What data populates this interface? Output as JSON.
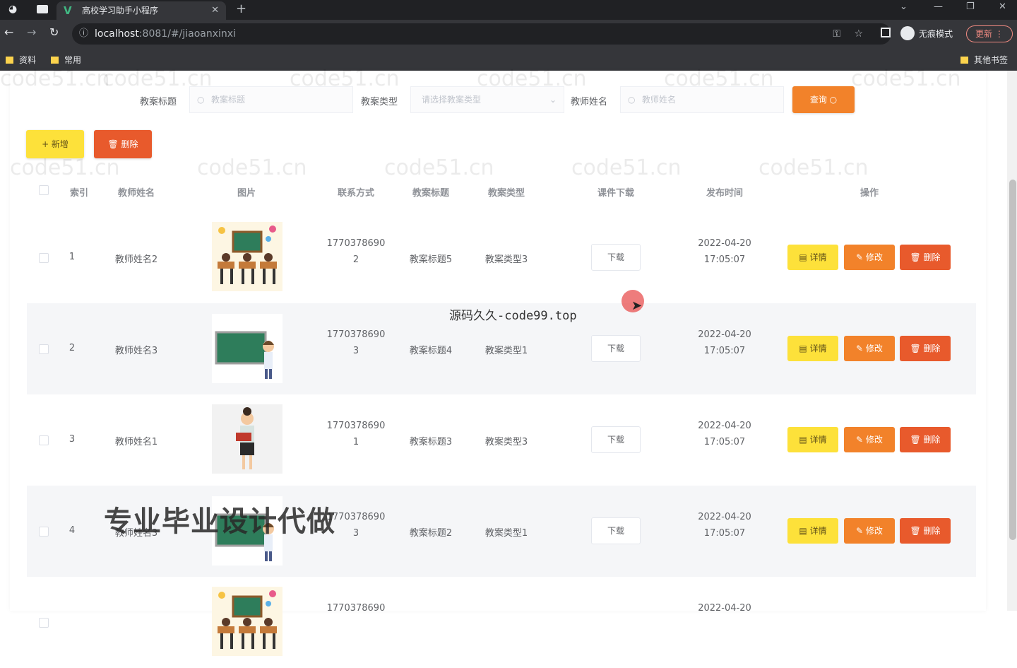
{
  "browser": {
    "tab_title": "高校学习助手小程序",
    "url_host": "localhost",
    "url_rest": ":8081/#/jiaoanxinxi",
    "incognito_label": "无痕模式",
    "update_label": "更新",
    "bookmarks": [
      "资料",
      "常用"
    ],
    "other_bookmarks": "其他书签"
  },
  "search": {
    "title_label": "教案标题",
    "title_placeholder": "教案标题",
    "type_label": "教案类型",
    "type_placeholder": "请选择教案类型",
    "teacher_label": "教师姓名",
    "teacher_placeholder": "教师姓名",
    "search_button": "查询"
  },
  "actions": {
    "add_label": "+ 新增",
    "delete_label": "删除"
  },
  "table": {
    "headers": {
      "index": "索引",
      "teacher": "教师姓名",
      "image": "图片",
      "contact": "联系方式",
      "title": "教案标题",
      "type": "教案类型",
      "download": "课件下载",
      "time": "发布时间",
      "ops": "操作"
    },
    "rows": [
      {
        "index": "1",
        "teacher": "教师姓名2",
        "contact_a": "1770378690",
        "contact_b": "2",
        "title": "教案标题5",
        "type": "教案类型3",
        "download": "下载",
        "date": "2022-04-20",
        "time": "17:05:07",
        "image": "classroom-students"
      },
      {
        "index": "2",
        "teacher": "教师姓名3",
        "contact_a": "1770378690",
        "contact_b": "3",
        "title": "教案标题4",
        "type": "教案类型1",
        "download": "下载",
        "date": "2022-04-20",
        "time": "17:05:07",
        "image": "teacher-blackboard"
      },
      {
        "index": "3",
        "teacher": "教师姓名1",
        "contact_a": "1770378690",
        "contact_b": "1",
        "title": "教案标题3",
        "type": "教案类型3",
        "download": "下载",
        "date": "2022-04-20",
        "time": "17:05:07",
        "image": "teacher-reading"
      },
      {
        "index": "4",
        "teacher": "教师姓名3",
        "contact_a": "1770378690",
        "contact_b": "3",
        "title": "教案标题2",
        "type": "教案类型1",
        "download": "下载",
        "date": "2022-04-20",
        "time": "17:05:07",
        "image": "teacher-blackboard"
      },
      {
        "index": "",
        "teacher": "",
        "contact_a": "1770378690",
        "contact_b": "",
        "title": "",
        "type": "",
        "download": "",
        "date": "2022-04-20",
        "time": "",
        "image": "classroom-students"
      }
    ],
    "op_labels": {
      "detail": "详情",
      "edit": "修改",
      "delete": "删除"
    }
  },
  "overlays": {
    "source_text": "源码久久-code99.top",
    "promo_text": "专业毕业设计代做",
    "watermark": "code51.cn"
  },
  "colors": {
    "yellow": "#fde13a",
    "orange": "#f2822a",
    "red": "#e85a2c"
  }
}
